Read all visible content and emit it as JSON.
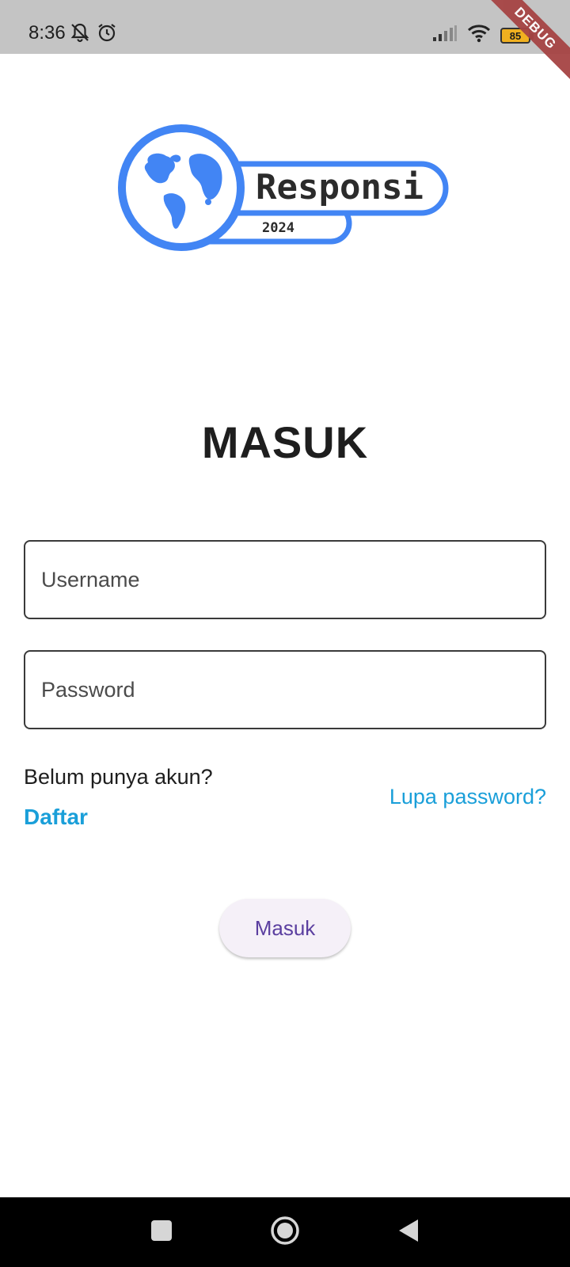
{
  "status_bar": {
    "time": "8:36",
    "battery_level": "85",
    "icons": [
      "bell-off-icon",
      "alarm-icon",
      "signal-icon",
      "wifi-icon",
      "battery-icon"
    ]
  },
  "debug_banner": "DEBUG",
  "logo": {
    "name": "Responsi",
    "year": "2024",
    "color": "#4285f4"
  },
  "login": {
    "title": "MASUK",
    "username_placeholder": "Username",
    "password_placeholder": "Password",
    "no_account_prompt": "Belum punya akun?",
    "register_link": "Daftar",
    "forgot_password_link": "Lupa password?",
    "submit_label": "Masuk"
  },
  "colors": {
    "link": "#1a9fd9",
    "button_text": "#5b3fa0",
    "button_bg": "#f5f0f8"
  },
  "nav_bar": {
    "buttons": [
      "recents-icon",
      "home-icon",
      "back-icon"
    ]
  }
}
